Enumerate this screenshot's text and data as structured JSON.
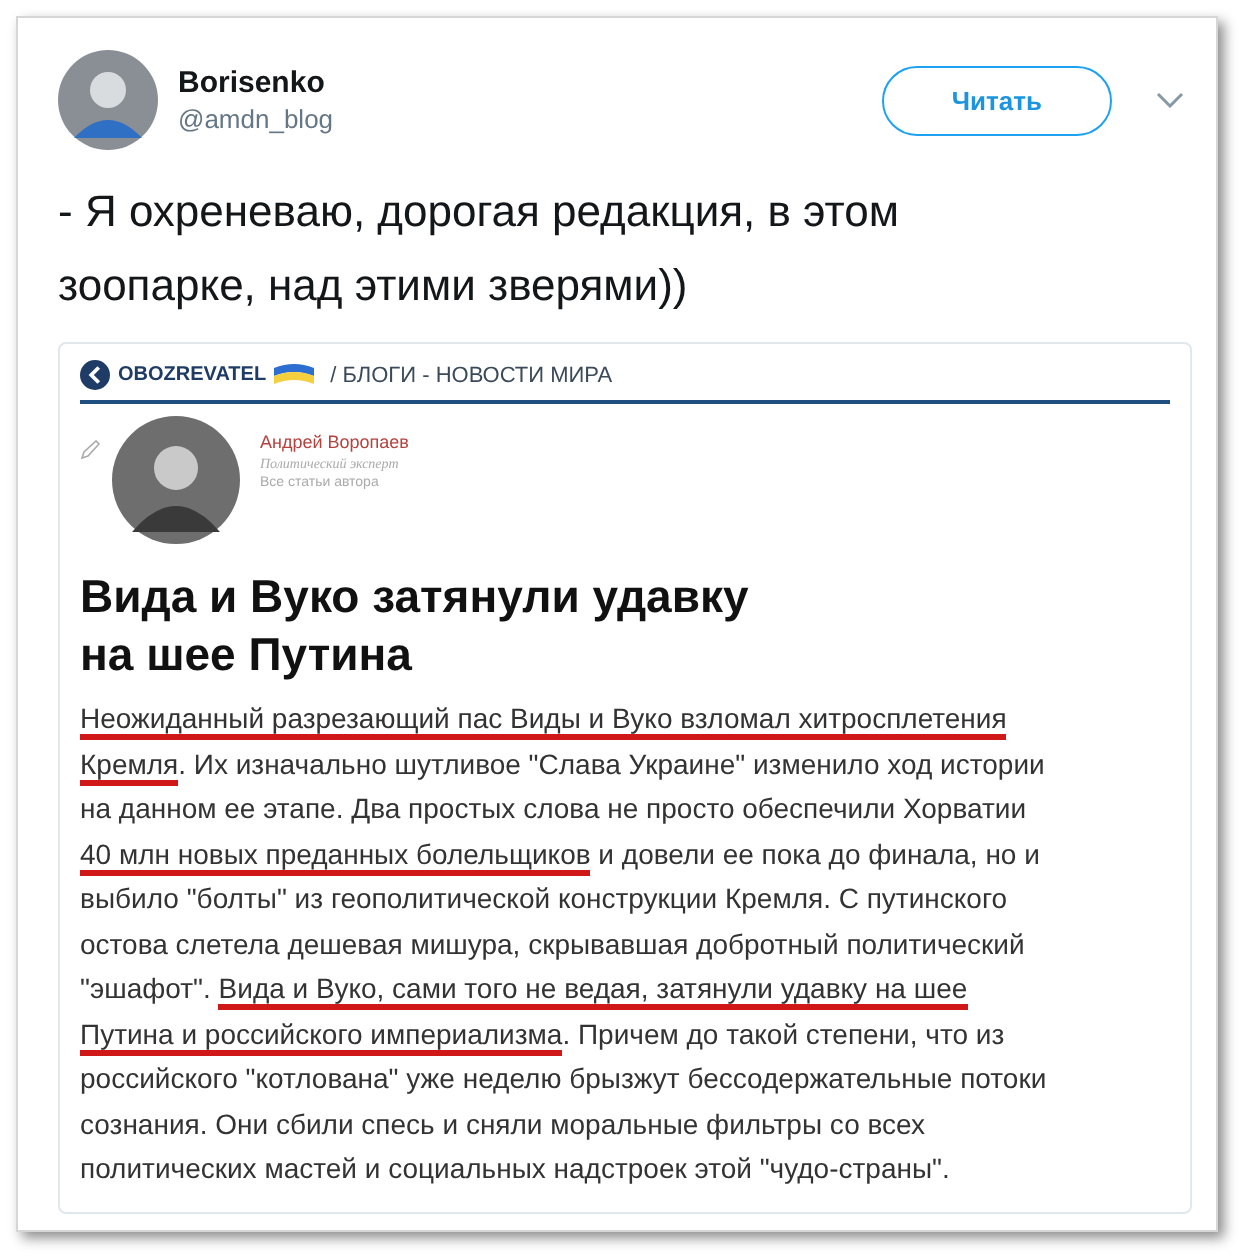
{
  "tweet": {
    "author": {
      "name": "Borisenko",
      "handle": "@amdn_blog"
    },
    "follow_button": "Читать",
    "text_lines": [
      "- Я охреневаю, дорогая редакция, в этом",
      "зоопарке, над этими зверями))"
    ],
    "embedded_screenshot": {
      "site": {
        "logo": "OBOZREVATEL",
        "breadcrumb": "/ БЛОГИ - НОВОСТИ МИРА"
      },
      "author": {
        "name": "Андрей Воропаев",
        "role": "Политический эксперт",
        "link": "Все статьи автора"
      },
      "headline_lines": [
        "Вида и Вуко затянули удавку",
        "на шее Путина"
      ],
      "body_lines": [
        [
          {
            "text": "Неожиданный разрезающий пас Виды и Вуко взломал хитросплетения",
            "underlined": true
          }
        ],
        [
          {
            "text": "Кремля",
            "underlined": true
          },
          {
            "text": ". Их изначально шутливое \"Слава Украине\" изменило ход истории",
            "underlined": false
          }
        ],
        [
          {
            "text": "на данном ее этапе. Два простых слова не просто обеспечили Хорватии",
            "underlined": false
          }
        ],
        [
          {
            "text": "40 млн новых преданных болельщиков",
            "underlined": true
          },
          {
            "text": " и довели ее пока до финала, но и",
            "underlined": false
          }
        ],
        [
          {
            "text": "выбило \"болты\" из геополитической конструкции Кремля. С путинского",
            "underlined": false
          }
        ],
        [
          {
            "text": "остова слетела дешевая мишура, скрывавшая добротный политический",
            "underlined": false
          }
        ],
        [
          {
            "text": "\"эшафот\". ",
            "underlined": false
          },
          {
            "text": "Вида и Вуко, сами того не ведая, затянули удавку на шее",
            "underlined": true
          }
        ],
        [
          {
            "text": "Путина и российского империализма",
            "underlined": true
          },
          {
            "text": ". Причем до такой степени, что из",
            "underlined": false
          }
        ],
        [
          {
            "text": "российского \"котлована\" уже неделю брызжут бессодержательные потоки",
            "underlined": false
          }
        ],
        [
          {
            "text": "сознания. Они сбили спесь и сняли моральные фильтры со всех",
            "underlined": false
          }
        ],
        [
          {
            "text": "политических мастей и социальных надстроек этой \"чудо-страны\".",
            "underlined": false
          }
        ]
      ]
    }
  }
}
